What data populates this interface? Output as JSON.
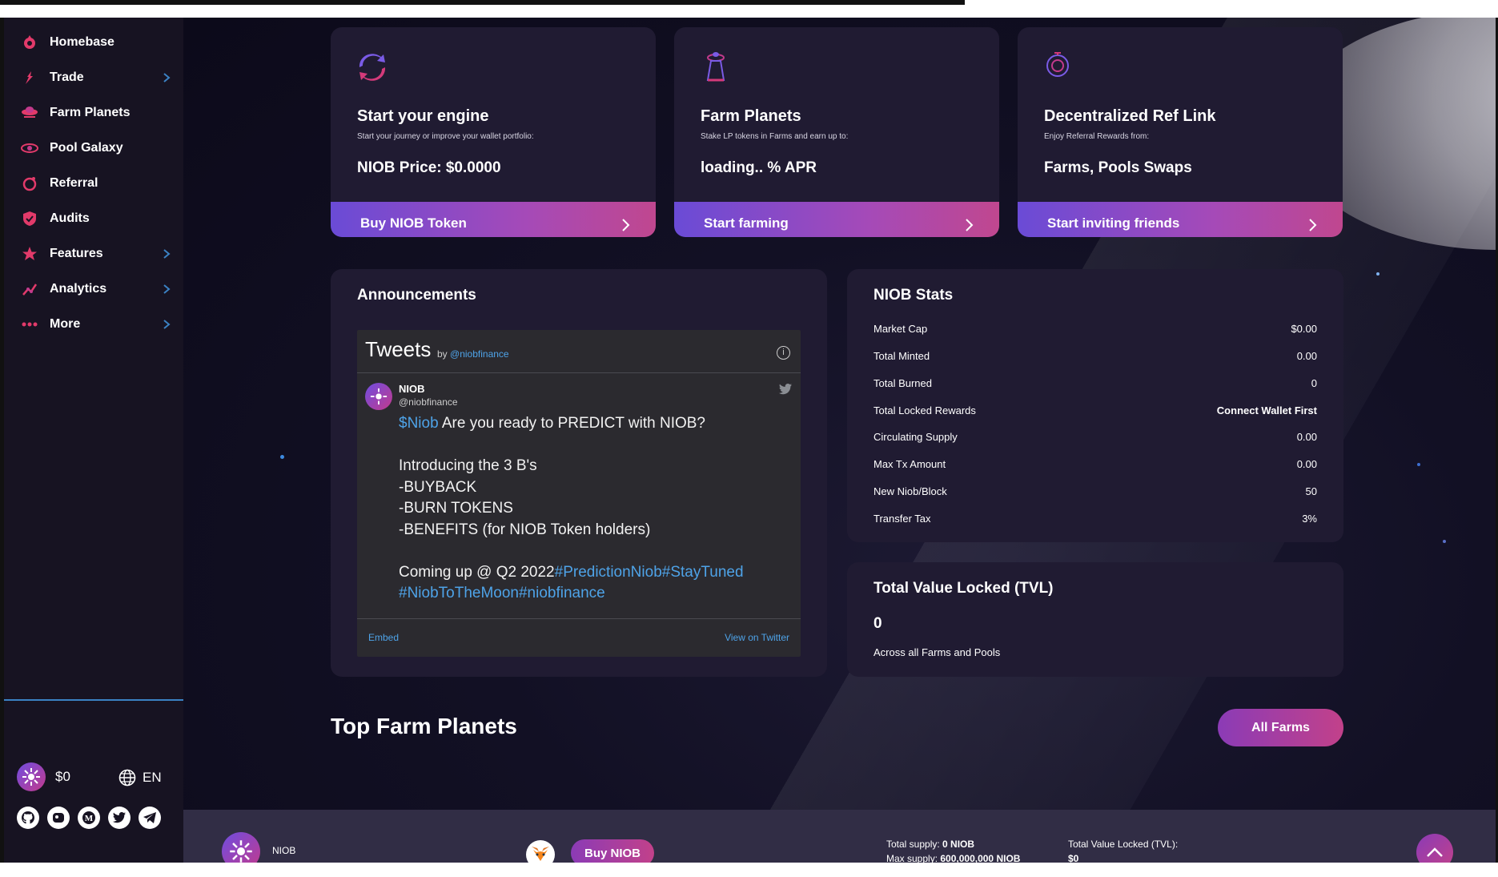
{
  "colors": {
    "accent_blue": "#3b82c4",
    "gradient_start": "#6a4bd6",
    "gradient_end": "#c0478f",
    "card_bg": "#201b32",
    "sidebar_bg": "#171322"
  },
  "sidebar": {
    "items": [
      {
        "label": "Homebase",
        "icon": "rocket-icon",
        "has_chevron": false
      },
      {
        "label": "Trade",
        "icon": "trade-icon",
        "has_chevron": true
      },
      {
        "label": "Farm Planets",
        "icon": "ufo-icon",
        "has_chevron": false
      },
      {
        "label": "Pool Galaxy",
        "icon": "galaxy-icon",
        "has_chevron": false
      },
      {
        "label": "Referral",
        "icon": "referral-icon",
        "has_chevron": false
      },
      {
        "label": "Audits",
        "icon": "shield-icon",
        "has_chevron": false
      },
      {
        "label": "Features",
        "icon": "star-icon",
        "has_chevron": true
      },
      {
        "label": "Analytics",
        "icon": "analytics-icon",
        "has_chevron": true
      },
      {
        "label": "More",
        "icon": "more-dots-icon",
        "has_chevron": true
      }
    ],
    "price": "$0",
    "language": "EN",
    "socials": [
      "github-icon",
      "coingecko-icon",
      "medium-icon",
      "twitter-icon",
      "telegram-icon"
    ]
  },
  "cards": [
    {
      "title": "Start your engine",
      "subtitle": "Start your journey or improve your wallet portfolio:",
      "value": "NIOB Price: $0.0000",
      "button": "Buy NIOB Token",
      "icon": "refresh-icon"
    },
    {
      "title": "Farm Planets",
      "subtitle": "Stake LP tokens in Farms and earn up to:",
      "value": "loading.. % APR",
      "button": "Start farming",
      "icon": "ufo-icon"
    },
    {
      "title": "Decentralized Ref Link",
      "subtitle": "Enjoy Referral Rewards from:",
      "value": "Farms, Pools Swaps",
      "button": "Start inviting friends",
      "icon": "astronaut-icon"
    }
  ],
  "announcements": {
    "title": "Announcements",
    "widget_title": "Tweets",
    "by": "by",
    "handle_link": "@niobfinance",
    "tweet": {
      "name": "NIOB",
      "handle": "@niobfinance",
      "cashtag": "$Niob",
      "line1": " Are you ready to PREDICT with NIOB?",
      "line2": "Introducing the 3 B's",
      "line3": "-BUYBACK",
      "line4": "-BURN TOKENS",
      "line5": "-BENEFITS (for NIOB Token holders)",
      "line6": "Coming up @ Q2 2022",
      "tag1": "#PredictionNiob",
      "tag2": "#StayTuned",
      "tag3": "#NiobToTheMoon",
      "tag4": "#niobfinance"
    },
    "embed": "Embed",
    "view": "View on Twitter"
  },
  "stats": {
    "title": "NIOB Stats",
    "rows": [
      {
        "k": "Market Cap",
        "v": "$0.00"
      },
      {
        "k": "Total Minted",
        "v": "0.00"
      },
      {
        "k": "Total Burned",
        "v": "0"
      },
      {
        "k": "Total Locked Rewards",
        "v": "Connect Wallet First"
      },
      {
        "k": "Circulating Supply",
        "v": "0.00"
      },
      {
        "k": "Max Tx Amount",
        "v": "0.00"
      },
      {
        "k": "New Niob/Block",
        "v": "50"
      },
      {
        "k": "Transfer Tax",
        "v": "3%"
      }
    ]
  },
  "tvl": {
    "title": "Total Value Locked (TVL)",
    "value": "0",
    "subtitle": "Across all Farms and Pools"
  },
  "top_farms": {
    "title": "Top Farm Planets",
    "button": "All Farms"
  },
  "footer": {
    "brand": "NIOB",
    "buy": "Buy NIOB",
    "total_supply_label": "Total supply:",
    "total_supply_value": "0 NIOB",
    "max_supply_label": "Max supply:",
    "max_supply_value": "600,000,000 NIOB",
    "tvl_label": "Total Value Locked (TVL):",
    "tvl_value": "$0"
  }
}
